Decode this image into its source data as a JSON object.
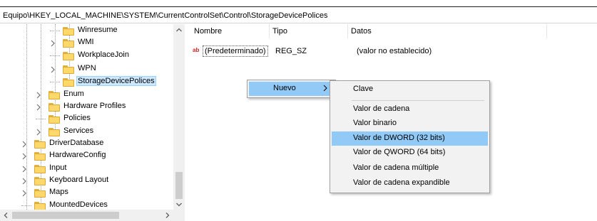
{
  "address_bar": {
    "path": "Equipo\\HKEY_LOCAL_MACHINE\\SYSTEM\\CurrentControlSet\\Control\\StorageDevicePolices"
  },
  "tree": {
    "items": [
      {
        "label": "Winresume",
        "expander": "none"
      },
      {
        "label": "WMI",
        "expander": "collapsed"
      },
      {
        "label": "WorkplaceJoin",
        "expander": "none"
      },
      {
        "label": "WPN",
        "expander": "collapsed"
      },
      {
        "label": "StorageDevicePolices",
        "expander": "none",
        "selected": true
      },
      {
        "label": "Enum",
        "expander": "collapsed"
      },
      {
        "label": "Hardware Profiles",
        "expander": "collapsed"
      },
      {
        "label": "Policies",
        "expander": "none"
      },
      {
        "label": "Services",
        "expander": "collapsed"
      },
      {
        "label": "DriverDatabase",
        "expander": "collapsed"
      },
      {
        "label": "HardwareConfig",
        "expander": "collapsed"
      },
      {
        "label": "Input",
        "expander": "collapsed"
      },
      {
        "label": "Keyboard Layout",
        "expander": "collapsed"
      },
      {
        "label": "Maps",
        "expander": "collapsed"
      },
      {
        "label": "MountedDevices",
        "expander": "none"
      }
    ]
  },
  "list": {
    "columns": [
      "Nombre",
      "Tipo",
      "Datos"
    ],
    "rows": [
      {
        "icon": "string-value-icon",
        "icon_text": "ab",
        "name": "(Predeterminado)",
        "type": "REG_SZ",
        "data": "(valor no establecido)"
      }
    ]
  },
  "context_menu": {
    "items": [
      {
        "label": "Nuevo",
        "has_submenu": true
      }
    ]
  },
  "submenu": {
    "items": [
      {
        "label": "Clave"
      },
      {
        "label": "Valor de cadena"
      },
      {
        "label": "Valor binario"
      },
      {
        "label": "Valor de DWORD (32 bits)",
        "highlighted": true
      },
      {
        "label": "Valor de QWORD (64 bits)"
      },
      {
        "label": "Valor de cadena múltiple"
      },
      {
        "label": "Valor de cadena expandible"
      }
    ]
  },
  "colors": {
    "menu_highlight": "#91c9f7",
    "tree_selection": "#cce8ff",
    "folder": "#ffd86b"
  }
}
